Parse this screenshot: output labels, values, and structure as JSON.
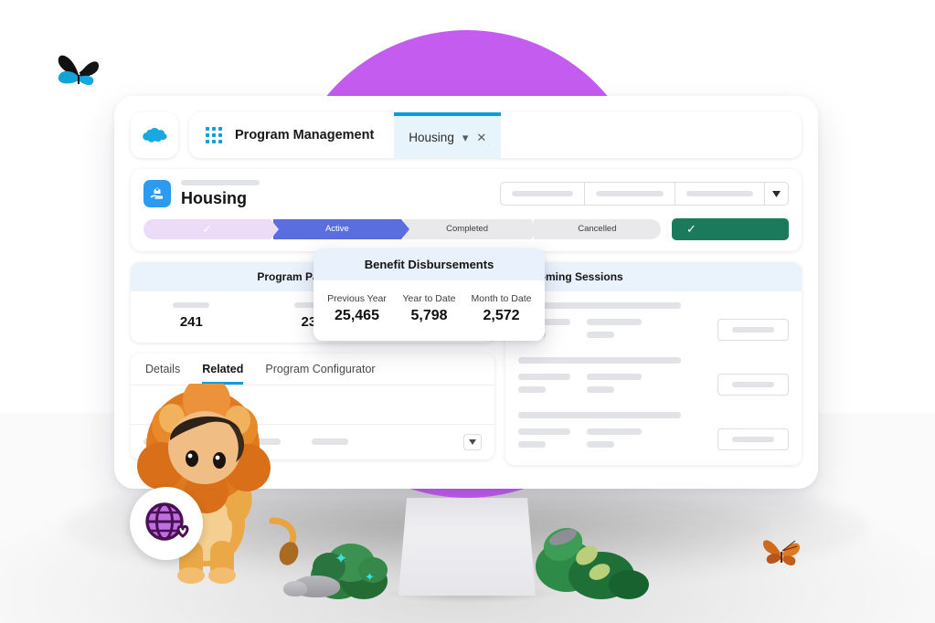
{
  "nav": {
    "logo_icon": "salesforce-cloud-icon",
    "app_launcher_icon": "app-launcher-grid-icon",
    "app_name": "Program Management",
    "tab_label": "Housing",
    "tab_caret_icon": "chevron-down-icon",
    "tab_close_icon": "close-icon"
  },
  "record": {
    "icon": "housing-care-icon",
    "title": "Housing",
    "actions": [
      {
        "name": "header-action-1"
      },
      {
        "name": "header-action-2"
      },
      {
        "name": "header-action-3"
      }
    ],
    "actions_caret_icon": "dropdown-caret-icon"
  },
  "path": {
    "steps": [
      {
        "label": "",
        "state": "complete",
        "icon": "check-icon"
      },
      {
        "label": "Active",
        "state": "active"
      },
      {
        "label": "Completed",
        "state": "upcoming"
      },
      {
        "label": "Cancelled",
        "state": "upcoming"
      }
    ],
    "action_button": {
      "label": "",
      "icon": "check-icon",
      "color": "#1c7a5c"
    }
  },
  "participants": {
    "title": "Program Participants",
    "stats": [
      {
        "value": "241"
      },
      {
        "value": "237"
      }
    ]
  },
  "benefit": {
    "title": "Benefit Disbursements",
    "metrics": [
      {
        "label": "Previous Year",
        "value": "25,465"
      },
      {
        "label": "Year to Date",
        "value": "5,798"
      },
      {
        "label": "Month to Date",
        "value": "2,572"
      }
    ]
  },
  "sessions": {
    "title": "Upcoming Sessions",
    "items": [
      {
        "name": "session-row-1"
      },
      {
        "name": "session-row-2"
      },
      {
        "name": "session-row-3"
      }
    ]
  },
  "tabs": {
    "items": [
      {
        "label": "Details",
        "active": false
      },
      {
        "label": "Related",
        "active": true
      },
      {
        "label": "Program Configurator",
        "active": false
      }
    ],
    "footer_caret_icon": "dropdown-caret-icon"
  },
  "scene": {
    "purple_circle_color": "#c45cf0",
    "butterfly_blue": "blue-butterfly-icon",
    "butterfly_orange": "monarch-butterfly-icon",
    "mascot": "lion-mascot",
    "badge_icon": "globe-heart-icon",
    "accent_blue": "#0d9dda",
    "active_step_color": "#5b6ee0"
  }
}
